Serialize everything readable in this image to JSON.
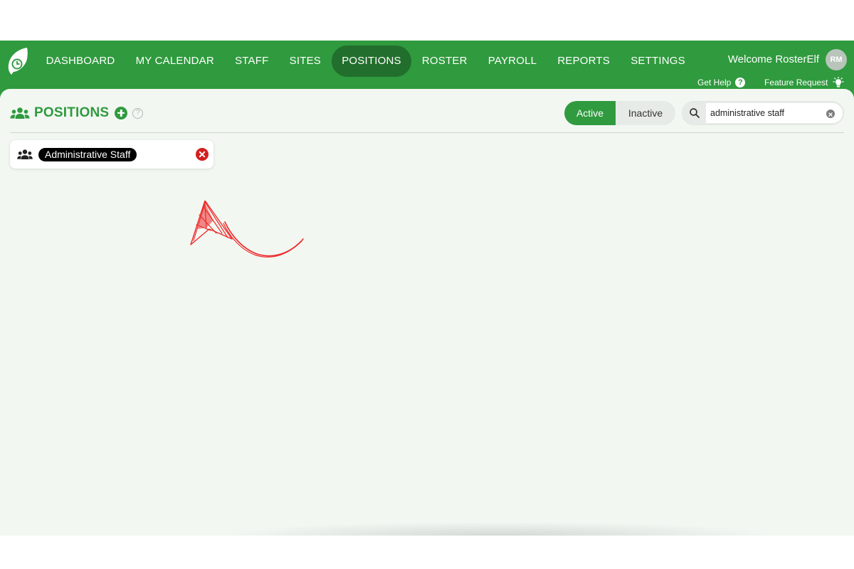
{
  "nav": {
    "items": [
      {
        "label": "DASHBOARD"
      },
      {
        "label": "MY CALENDAR"
      },
      {
        "label": "STAFF"
      },
      {
        "label": "SITES"
      },
      {
        "label": "POSITIONS",
        "active": true
      },
      {
        "label": "ROSTER"
      },
      {
        "label": "PAYROLL"
      },
      {
        "label": "REPORTS"
      },
      {
        "label": "SETTINGS"
      }
    ]
  },
  "user": {
    "welcome": "Welcome RosterElf",
    "initials": "RM"
  },
  "utility": {
    "get_help": "Get Help",
    "feature_request": "Feature Request"
  },
  "page": {
    "title": "POSITIONS"
  },
  "filter": {
    "active_label": "Active",
    "inactive_label": "Inactive",
    "selected": "Active"
  },
  "search": {
    "value": "administrative staff"
  },
  "positions": [
    {
      "name": "Administrative Staff"
    }
  ],
  "colors": {
    "brand_green": "#2f9a3e",
    "active_nav": "#226e2c",
    "delete_red": "#d42020",
    "annotation_red": "#ee2b2b"
  }
}
